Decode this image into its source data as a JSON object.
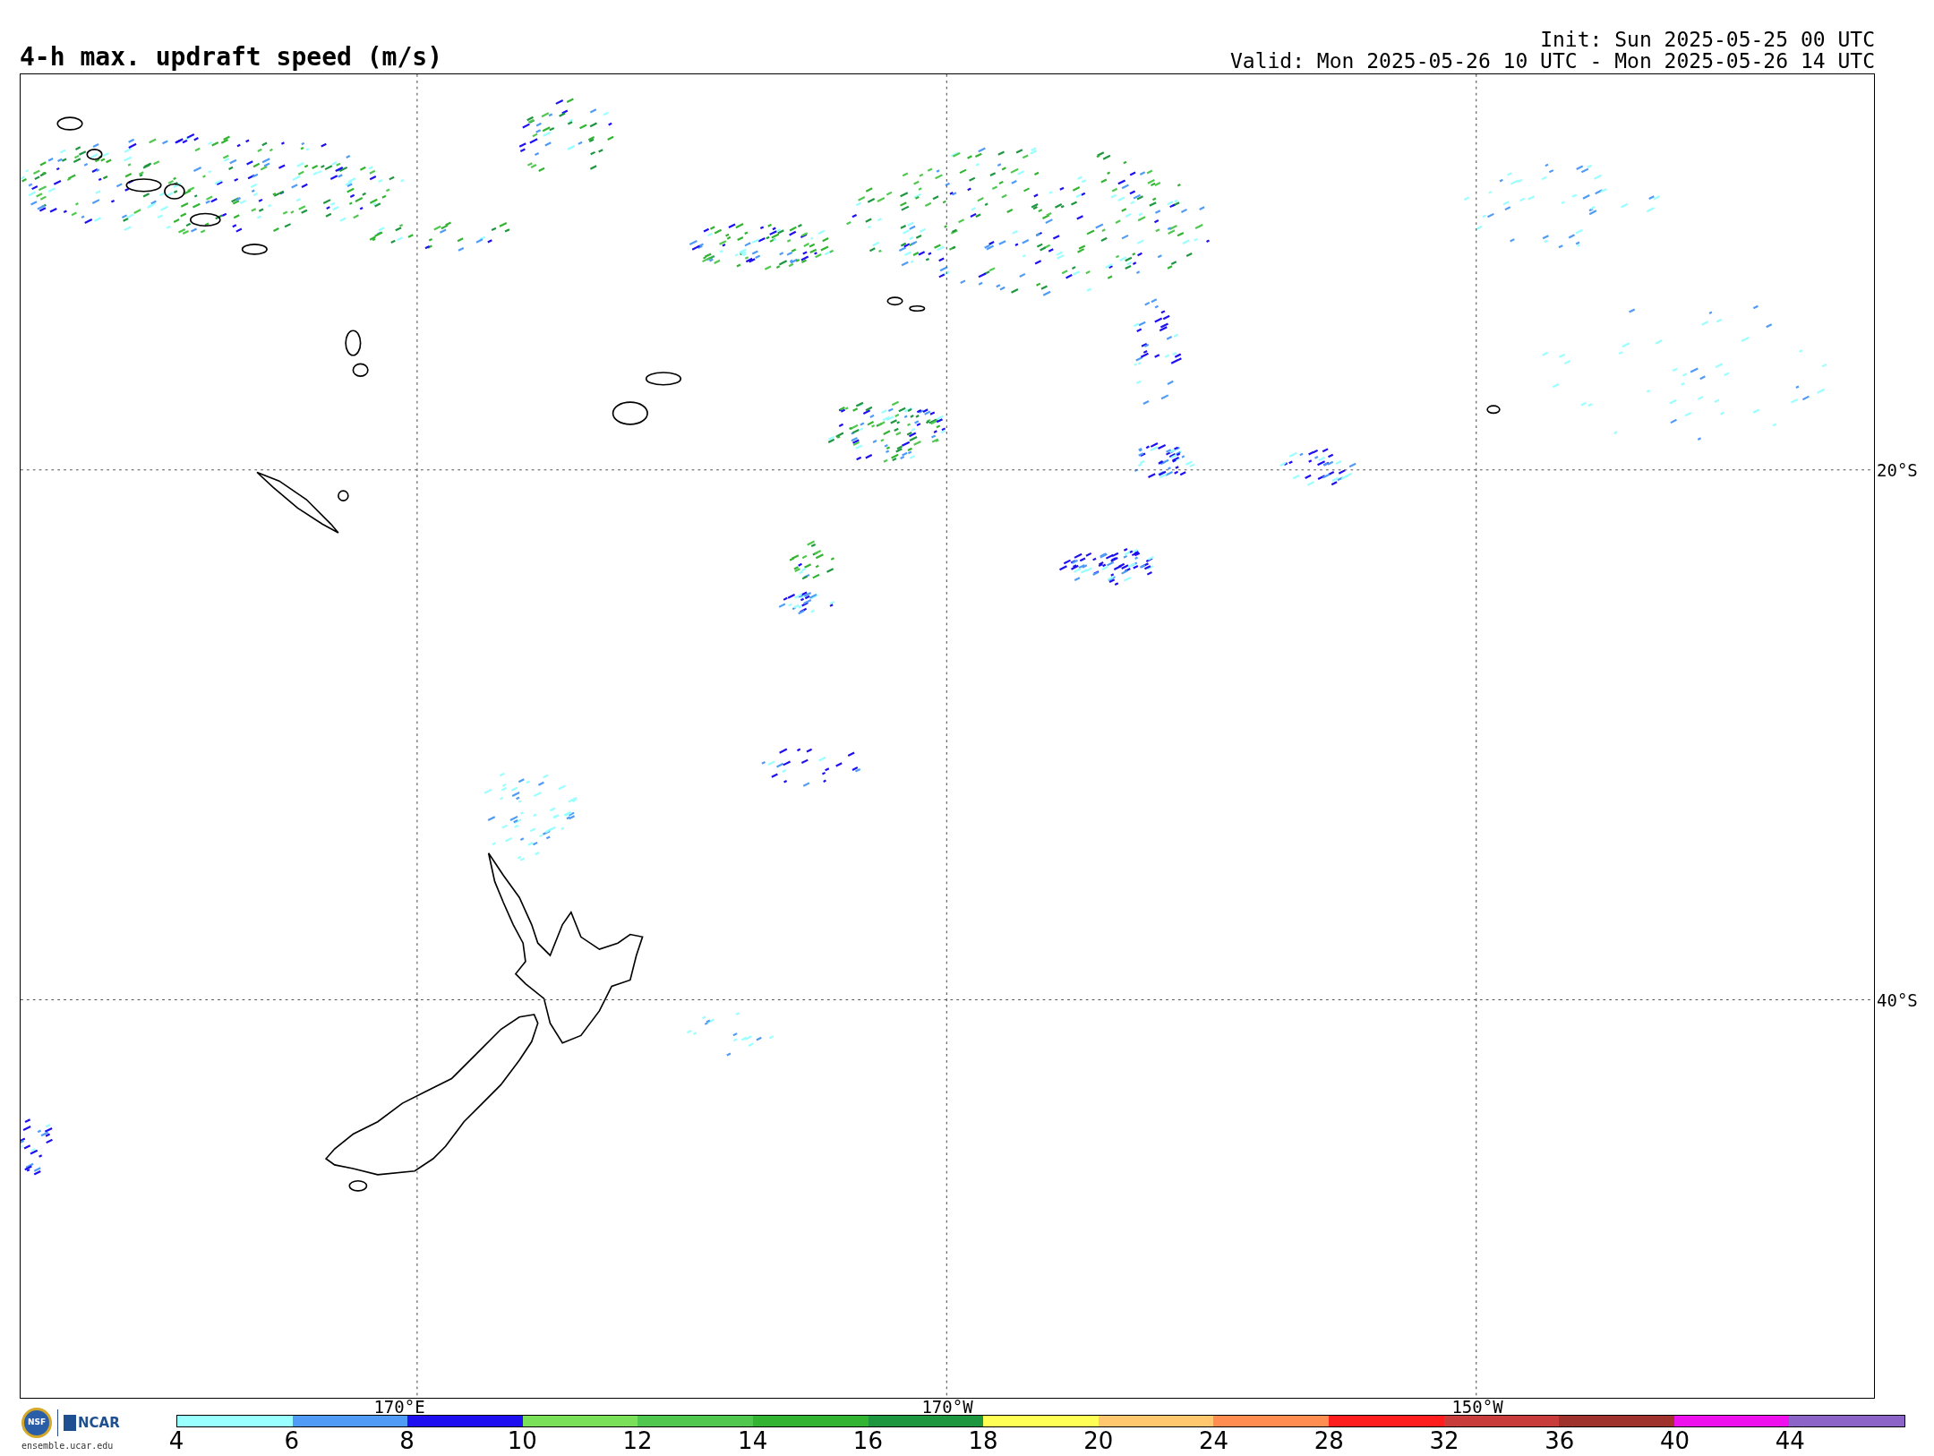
{
  "title": "4-h max. updraft speed (m/s)",
  "init": "Init: Sun 2025-05-25 00 UTC",
  "valid": "Valid: Mon 2025-05-26 10 UTC - Mon 2025-05-26 14 UTC",
  "map": {
    "lon_labels": [
      "170°E",
      "170°W",
      "150°W"
    ],
    "lat_labels": [
      "20°S",
      "40°S"
    ]
  },
  "colorbar": {
    "segments": [
      {
        "color": "#99ffff"
      },
      {
        "color": "#4f9bf5"
      },
      {
        "color": "#1e0ff0"
      },
      {
        "color": "#7ae05a"
      },
      {
        "color": "#50c850"
      },
      {
        "color": "#32b432"
      },
      {
        "color": "#1e9640"
      },
      {
        "color": "#ffff55"
      },
      {
        "color": "#ffc86e"
      },
      {
        "color": "#ff8c50"
      },
      {
        "color": "#ff1e1e"
      },
      {
        "color": "#c83c3c"
      },
      {
        "color": "#a0322d"
      },
      {
        "color": "#ee11ee"
      },
      {
        "color": "#8c64c8"
      }
    ],
    "tick_labels": [
      "4",
      "6",
      "8",
      "10",
      "12",
      "14",
      "16",
      "18",
      "20",
      "24",
      "28",
      "32",
      "36",
      "40",
      "44"
    ]
  },
  "logo": {
    "emblem": "NSF",
    "name": "NCAR",
    "url": "ensemble.ucar.edu"
  }
}
